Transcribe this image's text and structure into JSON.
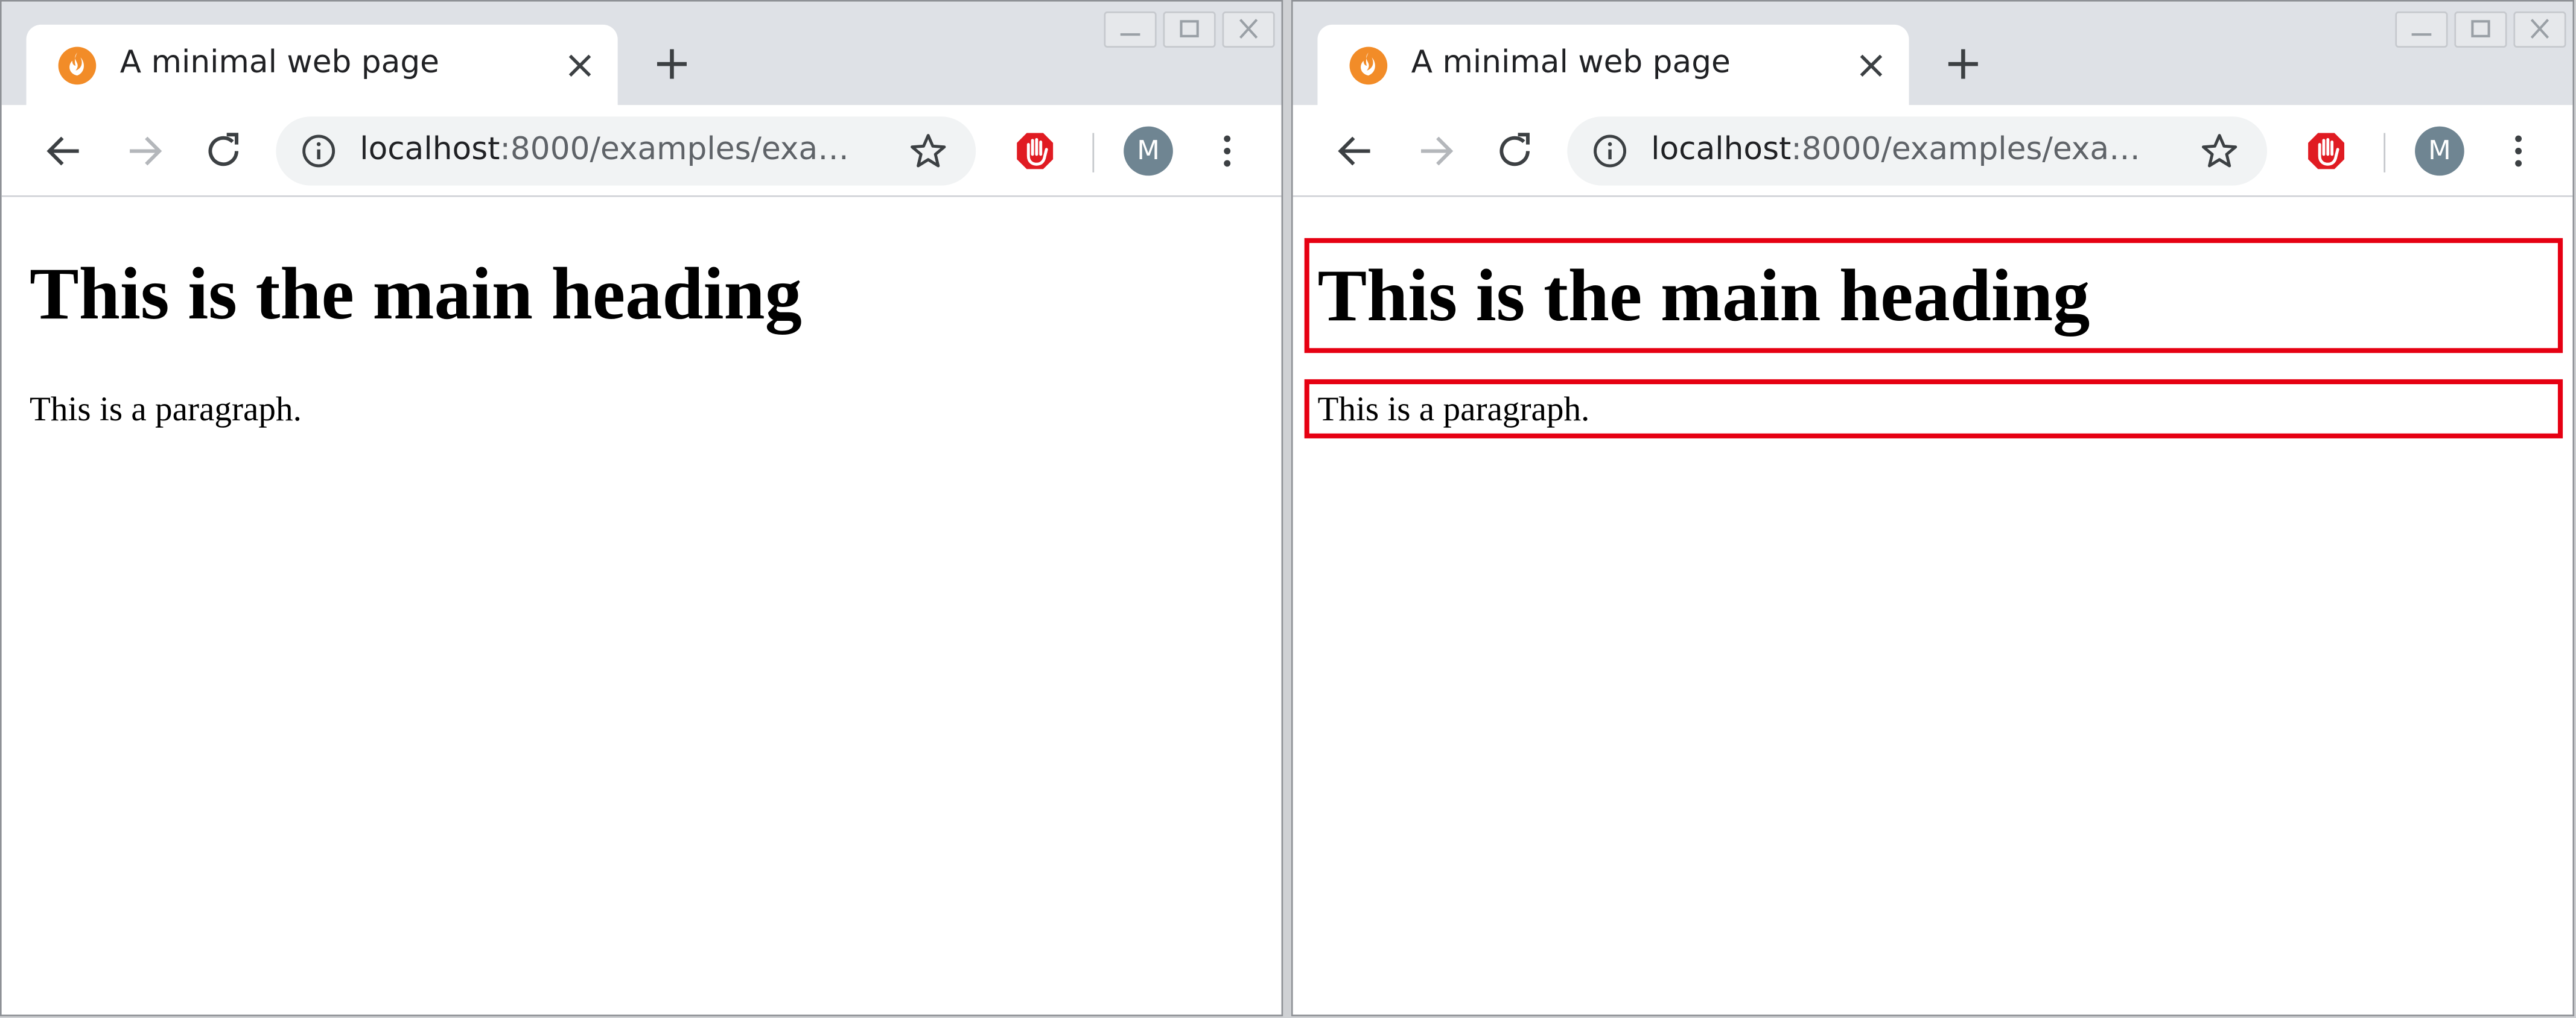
{
  "windows": [
    {
      "tab": {
        "title": "A minimal web page",
        "favicon": "flame-logo-icon"
      },
      "toolbar": {
        "url_host": "localhost",
        "url_rest": ":8000/examples/exa…",
        "profile_initial": "M"
      },
      "page": {
        "heading": "This is the main heading",
        "paragraph": "This is a paragraph."
      }
    },
    {
      "tab": {
        "title": "A minimal web page",
        "favicon": "flame-logo-icon"
      },
      "toolbar": {
        "url_host": "localhost",
        "url_rest": ":8000/examples/exa…",
        "profile_initial": "M"
      },
      "page": {
        "heading": "This is the main heading",
        "paragraph": "This is a paragraph.",
        "outline_color": "#e60012"
      }
    }
  ],
  "colors": {
    "tabstrip": "#dee1e6",
    "omnibox": "#f1f3f4",
    "avatar": "#6f8592",
    "adblock_red": "#e01b22",
    "favicon_orange": "#f28c28"
  }
}
